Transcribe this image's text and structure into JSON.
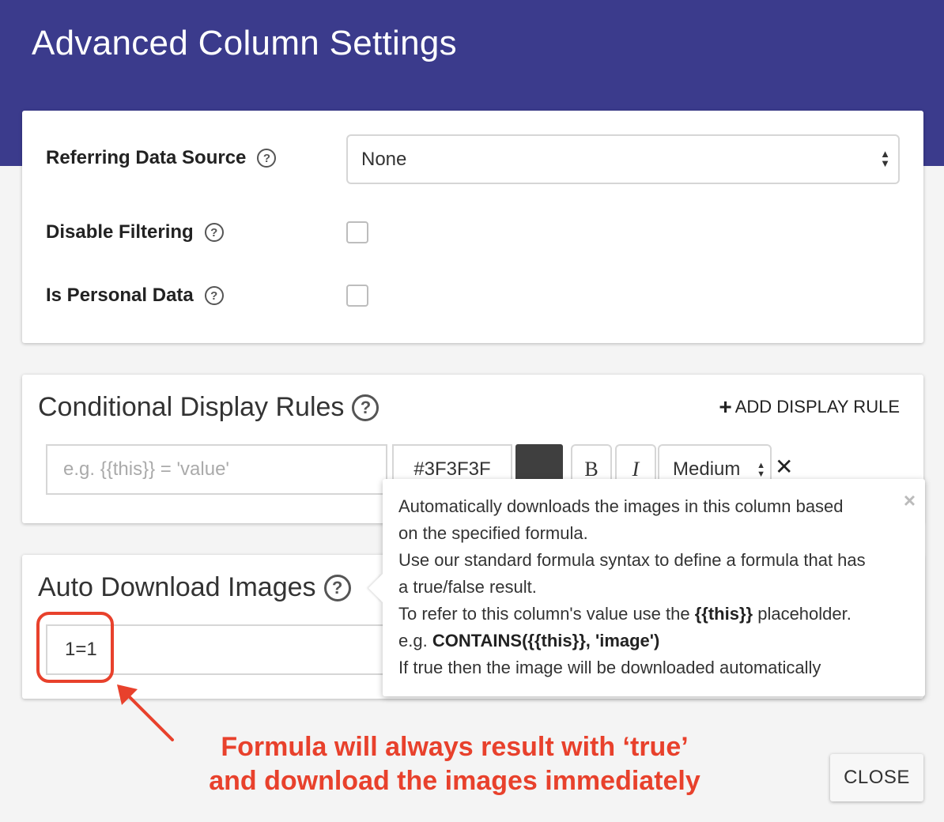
{
  "dialog": {
    "title": "Advanced Column Settings"
  },
  "settings": {
    "referring_source": {
      "label": "Referring Data Source",
      "value": "None"
    },
    "disable_filtering": {
      "label": "Disable Filtering",
      "checked": false
    },
    "personal_data": {
      "label": "Is Personal Data",
      "checked": false
    }
  },
  "display_rules": {
    "title": "Conditional Display Rules",
    "add_label": "ADD DISPLAY RULE",
    "rule": {
      "formula_placeholder": "e.g. {{this}} = 'value'",
      "color_value": "#3F3F3F",
      "swatch_color": "#3f3f3f",
      "bold_label": "B",
      "italic_label": "I",
      "size_value": "Medium"
    }
  },
  "auto_download": {
    "title": "Auto Download Images",
    "formula_value": "1=1"
  },
  "tooltip": {
    "line1": "Automatically downloads the images in this column based",
    "line2": "on the specified formula.",
    "line3": "Use our standard formula syntax to define a formula that has",
    "line4": "a true/false result.",
    "line5_pre": "To refer to this column's value use the ",
    "line5_bold": "{{this}}",
    "line5_post": " placeholder.",
    "line6_pre": "e.g. ",
    "line6_bold": "CONTAINS({{this}}, 'image')",
    "line7": "If true then the image will be downloaded automatically",
    "close_glyph": "×"
  },
  "annotation": {
    "line1": "Formula will always result with ‘true’",
    "line2": "and download the images immediately",
    "color": "#e8412c"
  },
  "footer": {
    "close_label": "CLOSE"
  },
  "icons": {
    "help": "?",
    "plus": "+",
    "remove": "✕",
    "up": "▲",
    "down": "▼"
  },
  "colors": {
    "header": "#3b3b8c",
    "accent": "#e8412c"
  }
}
